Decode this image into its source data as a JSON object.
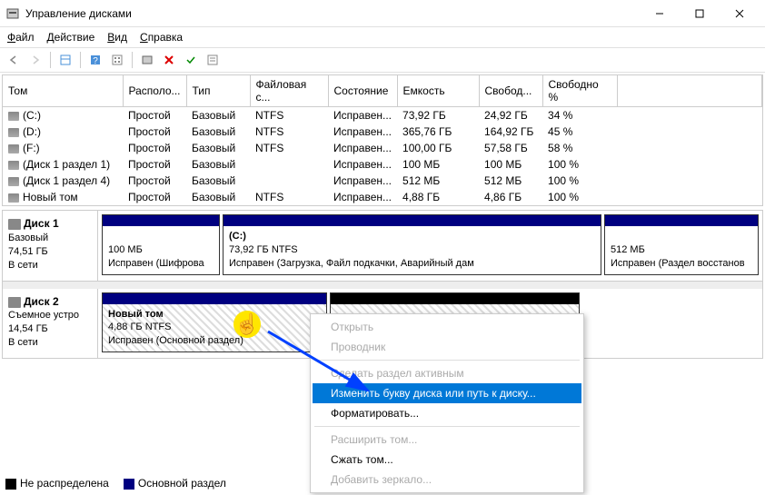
{
  "window": {
    "title": "Управление дисками"
  },
  "menu": {
    "file": "Файл",
    "action": "Действие",
    "view": "Вид",
    "help": "Справка"
  },
  "table": {
    "headers": [
      "Том",
      "Располо...",
      "Тип",
      "Файловая с...",
      "Состояние",
      "Емкость",
      "Свобод...",
      "Свободно %"
    ],
    "rows": [
      {
        "name": "(C:)",
        "layout": "Простой",
        "type": "Базовый",
        "fs": "NTFS",
        "status": "Исправен...",
        "cap": "73,92 ГБ",
        "free": "24,92 ГБ",
        "pct": "34 %"
      },
      {
        "name": "(D:)",
        "layout": "Простой",
        "type": "Базовый",
        "fs": "NTFS",
        "status": "Исправен...",
        "cap": "365,76 ГБ",
        "free": "164,92 ГБ",
        "pct": "45 %"
      },
      {
        "name": "(F:)",
        "layout": "Простой",
        "type": "Базовый",
        "fs": "NTFS",
        "status": "Исправен...",
        "cap": "100,00 ГБ",
        "free": "57,58 ГБ",
        "pct": "58 %"
      },
      {
        "name": "(Диск 1 раздел 1)",
        "layout": "Простой",
        "type": "Базовый",
        "fs": "",
        "status": "Исправен...",
        "cap": "100 МБ",
        "free": "100 МБ",
        "pct": "100 %"
      },
      {
        "name": "(Диск 1 раздел 4)",
        "layout": "Простой",
        "type": "Базовый",
        "fs": "",
        "status": "Исправен...",
        "cap": "512 МБ",
        "free": "512 МБ",
        "pct": "100 %"
      },
      {
        "name": "Новый том",
        "layout": "Простой",
        "type": "Базовый",
        "fs": "NTFS",
        "status": "Исправен...",
        "cap": "4,88 ГБ",
        "free": "4,86 ГБ",
        "pct": "100 %"
      }
    ]
  },
  "disk1": {
    "title": "Диск 1",
    "type": "Базовый",
    "size": "74,51 ГБ",
    "status": "В сети",
    "p1": {
      "size": "100 МБ",
      "status": "Исправен (Шифрова"
    },
    "p2": {
      "label": "(C:)",
      "size": "73,92 ГБ NTFS",
      "status": "Исправен (Загрузка, Файл подкачки, Аварийный дам"
    },
    "p3": {
      "size": "512 МБ",
      "status": "Исправен (Раздел восстанов"
    }
  },
  "disk2": {
    "title": "Диск 2",
    "type": "Съемное устро",
    "size": "14,54 ГБ",
    "status": "В сети",
    "p1": {
      "label": "Новый том",
      "size": "4,88 ГБ NTFS",
      "status": "Исправен (Основной раздел)"
    }
  },
  "legend": {
    "unalloc": "Не распределена",
    "primary": "Основной раздел"
  },
  "ctx": {
    "open": "Открыть",
    "explorer": "Проводник",
    "active": "Сделать раздел активным",
    "change": "Изменить букву диска или путь к диску...",
    "format": "Форматировать...",
    "extend": "Расширить том...",
    "shrink": "Сжать том...",
    "mirror": "Добавить зеркало..."
  }
}
